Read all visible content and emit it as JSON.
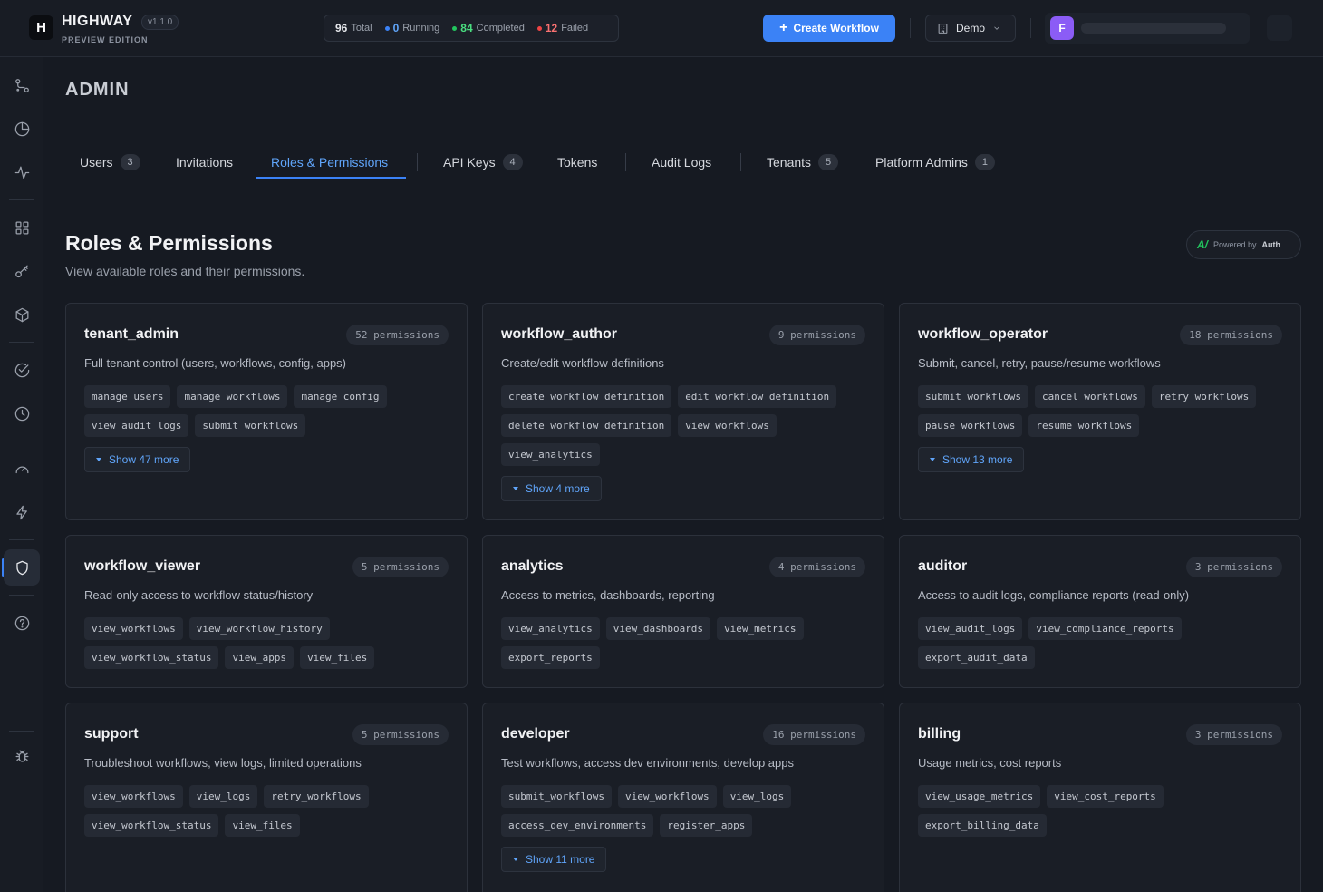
{
  "app": {
    "logo_letter": "H",
    "name": "HIGHWAY",
    "version": "v1.1.0",
    "edition": "PREVIEW EDITION"
  },
  "stats": {
    "total_value": "96",
    "total_label": "Total",
    "running_value": "0",
    "running_label": "Running",
    "completed_value": "84",
    "completed_label": "Completed",
    "failed_value": "12",
    "failed_label": "Failed"
  },
  "header": {
    "create_label": "Create Workflow",
    "tenant": "Demo",
    "avatar_letter": "F"
  },
  "colors": {
    "accent": "#3b82f6",
    "running": "#3b82f6",
    "completed": "#22c55e",
    "failed": "#ef4444",
    "avatar": "#8b5cf6"
  },
  "sidebar": {
    "icons": [
      "workflow-icon",
      "pie-chart-icon",
      "activity-icon",
      "grid-icon",
      "key-icon",
      "package-icon",
      "check-circle-icon",
      "clock-icon",
      "gauge-icon",
      "zap-icon",
      "shield-icon",
      "help-icon",
      "bug-icon"
    ],
    "active": "shield-icon"
  },
  "page": {
    "title": "ADMIN"
  },
  "tabs": [
    {
      "label": "Users",
      "badge": "3"
    },
    {
      "label": "Invitations"
    },
    {
      "label": "Roles & Permissions",
      "active": true
    },
    {
      "label": "API Keys",
      "badge": "4"
    },
    {
      "label": "Tokens"
    },
    {
      "label": "Audit Logs"
    },
    {
      "label": "Tenants",
      "badge": "5"
    },
    {
      "label": "Platform Admins",
      "badge": "1"
    }
  ],
  "section": {
    "title": "Roles & Permissions",
    "subtitle": "View available roles and their permissions.",
    "powered_logo": "A/",
    "powered_prefix": "Powered by",
    "powered_name": "Auth"
  },
  "roles": [
    {
      "name": "tenant_admin",
      "count": "52 permissions",
      "description": "Full tenant control (users, workflows, config, apps)",
      "permissions": [
        "manage_users",
        "manage_workflows",
        "manage_config",
        "view_audit_logs",
        "submit_workflows"
      ],
      "show_more": "Show 47 more"
    },
    {
      "name": "workflow_author",
      "count": "9 permissions",
      "description": "Create/edit workflow definitions",
      "permissions": [
        "create_workflow_definition",
        "edit_workflow_definition",
        "delete_workflow_definition",
        "view_workflows",
        "view_analytics"
      ],
      "show_more": "Show 4 more"
    },
    {
      "name": "workflow_operator",
      "count": "18 permissions",
      "description": "Submit, cancel, retry, pause/resume workflows",
      "permissions": [
        "submit_workflows",
        "cancel_workflows",
        "retry_workflows",
        "pause_workflows",
        "resume_workflows"
      ],
      "show_more": "Show 13 more"
    },
    {
      "name": "workflow_viewer",
      "count": "5 permissions",
      "description": "Read-only access to workflow status/history",
      "permissions": [
        "view_workflows",
        "view_workflow_history",
        "view_workflow_status",
        "view_apps",
        "view_files"
      ]
    },
    {
      "name": "analytics",
      "count": "4 permissions",
      "description": "Access to metrics, dashboards, reporting",
      "permissions": [
        "view_analytics",
        "view_dashboards",
        "view_metrics",
        "export_reports"
      ]
    },
    {
      "name": "auditor",
      "count": "3 permissions",
      "description": "Access to audit logs, compliance reports (read-only)",
      "permissions": [
        "view_audit_logs",
        "view_compliance_reports",
        "export_audit_data"
      ]
    },
    {
      "name": "support",
      "count": "5 permissions",
      "description": "Troubleshoot workflows, view logs, limited operations",
      "permissions": [
        "view_workflows",
        "view_logs",
        "retry_workflows",
        "view_workflow_status",
        "view_files"
      ]
    },
    {
      "name": "developer",
      "count": "16 permissions",
      "description": "Test workflows, access dev environments, develop apps",
      "permissions": [
        "submit_workflows",
        "view_workflows",
        "view_logs",
        "access_dev_environments",
        "register_apps"
      ],
      "show_more": "Show 11 more"
    },
    {
      "name": "billing",
      "count": "3 permissions",
      "description": "Usage metrics, cost reports",
      "permissions": [
        "view_usage_metrics",
        "view_cost_reports",
        "export_billing_data"
      ]
    }
  ]
}
